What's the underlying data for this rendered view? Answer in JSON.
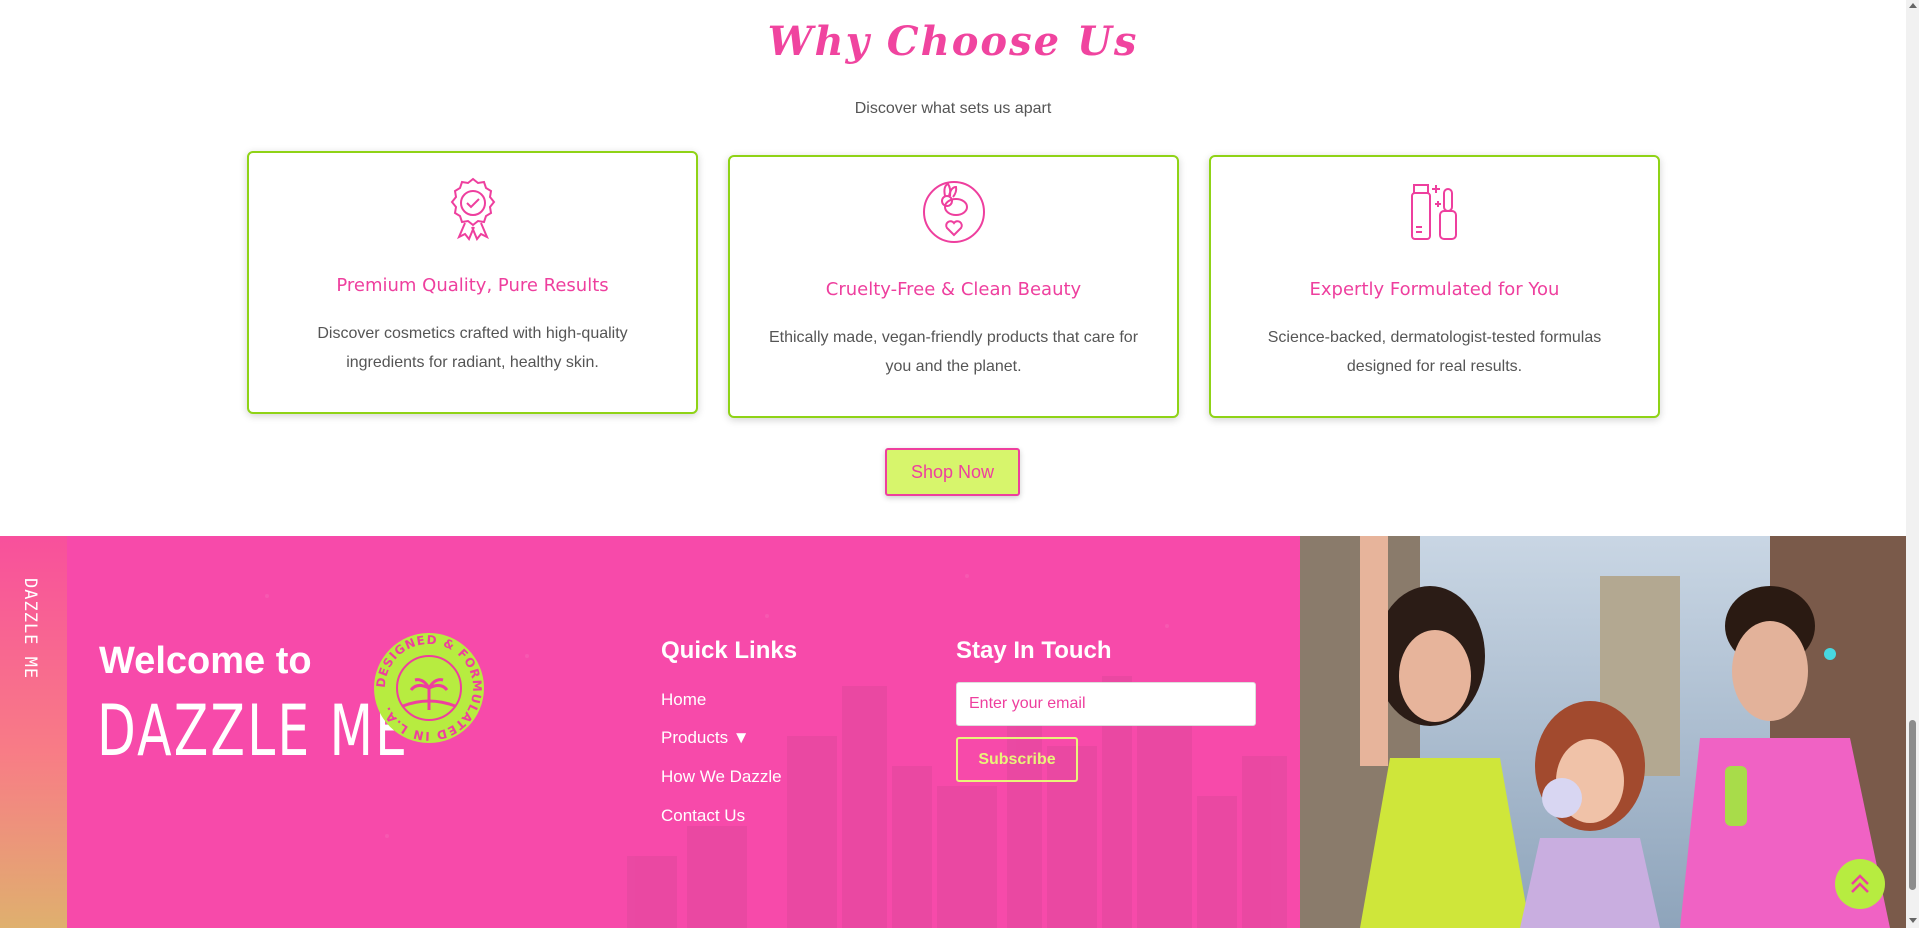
{
  "why": {
    "title": "Why Choose Us",
    "subtitle": "Discover what sets us apart",
    "cards": [
      {
        "title": "Premium Quality, Pure Results",
        "desc": "Discover cosmetics crafted with high-quality ingredients for radiant, healthy skin.",
        "icon": "award-badge-icon"
      },
      {
        "title": "Cruelty-Free & Clean Beauty",
        "desc": "Ethically made, vegan-friendly products that care for you and the planet.",
        "icon": "bunny-heart-icon"
      },
      {
        "title": "Expertly Formulated for You",
        "desc": "Science-backed, dermatologist-tested formulas designed for real results.",
        "icon": "cosmetics-bottle-icon"
      }
    ],
    "shop_label": "Shop Now"
  },
  "footer": {
    "side_label": "DAZZLE ME",
    "welcome": "Welcome to",
    "brand": "DAZZLE ME",
    "badge_text": "DESIGNED & FORMULATED IN L.A.",
    "quick_links_title": "Quick Links",
    "links": [
      "Home",
      "Products ▼",
      "How We Dazzle",
      "Contact Us"
    ],
    "stay_title": "Stay In Touch",
    "email_placeholder": "Enter your email",
    "subscribe_label": "Subscribe"
  },
  "colors": {
    "pink": "#f74aaa",
    "lime": "#b7ec40",
    "green_border": "#8fd316"
  }
}
